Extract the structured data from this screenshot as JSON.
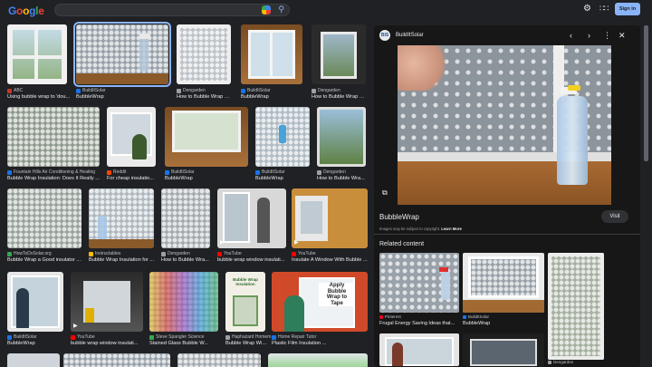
{
  "header": {
    "logo": "Google",
    "search_value": "",
    "signin_label": "Sign in"
  },
  "grid": [
    {
      "source": "ABC",
      "title": "Using bubble wrap to 'dou...",
      "color": "#c0392b"
    },
    {
      "source": "BuildItSolar",
      "title": "BubbleWrap",
      "color": "#1a73e8"
    },
    {
      "source": "Dengarden",
      "title": "How to Bubble Wrap Wi...",
      "color": "#9aa0a6"
    },
    {
      "source": "BuildItSolar",
      "title": "BubbleWrap",
      "color": "#1a73e8"
    },
    {
      "source": "Dengarden",
      "title": "How to Bubble Wrap Wi...",
      "color": "#9aa0a6"
    },
    {
      "source": "Fountain Hills Air Conditioning & Heating",
      "title": "Bubble Wrap Insulation: Does It Really ...",
      "color": "#1a73e8"
    },
    {
      "source": "Reddit",
      "title": "For cheap insulatio...",
      "color": "#ff4500"
    },
    {
      "source": "BuildItSolar",
      "title": "BubbleWrap",
      "color": "#1a73e8"
    },
    {
      "source": "BuildItSolar",
      "title": "BubbleWrap",
      "color": "#1a73e8"
    },
    {
      "source": "Dengarden",
      "title": "How to Bubble Wra...",
      "color": "#9aa0a6"
    },
    {
      "source": "HowToDoSolar.org",
      "title": "Bubble Wrap a Good insulator ...",
      "color": "#34a853"
    },
    {
      "source": "Instructables",
      "title": "Bubble Wrap Insulation for ...",
      "color": "#fbbc05"
    },
    {
      "source": "Dengarden",
      "title": "How to Bubble Wra...",
      "color": "#9aa0a6"
    },
    {
      "source": "YouTube",
      "title": "bubble wrap window insulati...",
      "color": "#ff0000"
    },
    {
      "source": "YouTube",
      "title": "Insulate A Window With Bubble ...",
      "color": "#ff0000"
    },
    {
      "source": "BuildItSolar",
      "title": "BubbleWrap",
      "color": "#1a73e8"
    },
    {
      "source": "YouTube",
      "title": "bubble wrap window insulati...",
      "color": "#ff0000"
    },
    {
      "source": "Steve Spangler Science",
      "title": "Stained Glass Bubble W...",
      "color": "#34a853"
    },
    {
      "source": "Haphazard Homem...",
      "title": "Bubble Wrap Windo...",
      "color": "#9aa0a6"
    },
    {
      "source": "Home Repair Tutor",
      "title": "Plastic Film Insulation ...",
      "color": "#1a73e8"
    }
  ],
  "overlay_text": {
    "bubble_wrap_sign_line1": "Bubble Wrap Insulation",
    "apply_sign_line1": "Apply",
    "apply_sign_line2": "Bubble",
    "apply_sign_line3": "Wrap to",
    "apply_sign_line4": "Tape"
  },
  "panel": {
    "site_logo_text": "BIS",
    "site_name": "BuildItSolar",
    "title": "BubbleWrap",
    "visit_label": "Visit",
    "copyright_text": "Images may be subject to copyright.",
    "learn_more": "Learn More",
    "related_heading": "Related content",
    "related": [
      {
        "source": "Pinterest",
        "title": "Frugal Energy Saving Ideas that...",
        "color": "#e60023"
      },
      {
        "source": "BuildItSolar",
        "title": "BubbleWrap",
        "color": "#1a73e8"
      },
      {
        "source": "Dengarden",
        "title": "",
        "color": "#9aa0a6"
      }
    ]
  },
  "icons": [
    "google-lens-icon",
    "search-icon",
    "settings-gear-icon",
    "apps-grid-icon",
    "chevron-left-icon",
    "chevron-right-icon",
    "more-vert-icon",
    "close-icon",
    "lens-search-icon",
    "play-icon"
  ]
}
